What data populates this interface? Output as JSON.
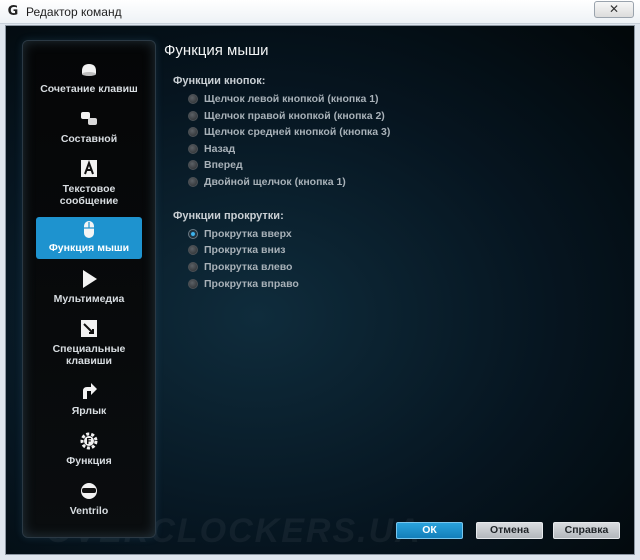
{
  "window": {
    "title": "Редактор команд",
    "app_glyph": "G",
    "close_glyph": "✕"
  },
  "sidebar": {
    "items": [
      {
        "label": "Сочетание клавиш",
        "icon": "key-combo-icon"
      },
      {
        "label": "Составной",
        "icon": "multikey-icon"
      },
      {
        "label": "Текстовое сообщение",
        "icon": "text-block-icon"
      },
      {
        "label": "Функция мыши",
        "icon": "mouse-icon",
        "active": true
      },
      {
        "label": "Мультимедиа",
        "icon": "play-icon"
      },
      {
        "label": "Специальные клавиши",
        "icon": "special-key-icon"
      },
      {
        "label": "Ярлык",
        "icon": "shortcut-arrow-icon"
      },
      {
        "label": "Функция",
        "icon": "function-gear-icon"
      },
      {
        "label": "Ventrilo",
        "icon": "ventrilo-headset-icon"
      }
    ]
  },
  "main": {
    "title": "Функция мыши",
    "buttons_section": {
      "title": "Функции кнопок:",
      "options": [
        "Щелчок левой кнопкой (кнопка 1)",
        "Щелчок правой кнопкой (кнопка 2)",
        "Щелчок средней кнопкой (кнопка 3)",
        "Назад",
        "Вперед",
        "Двойной щелчок (кнопка 1)"
      ]
    },
    "scroll_section": {
      "title": "Функции прокрутки:",
      "options": [
        "Прокрутка вверх",
        "Прокрутка вниз",
        "Прокрутка влево",
        "Прокрутка вправо"
      ],
      "selected": "Прокрутка вверх"
    }
  },
  "footer": {
    "ok_label": "ОК",
    "cancel_label": "Отмена",
    "help_label": "Справка"
  },
  "colors": {
    "accent": "#1e93cf",
    "background": "#061520",
    "text": "#d8dde1"
  }
}
